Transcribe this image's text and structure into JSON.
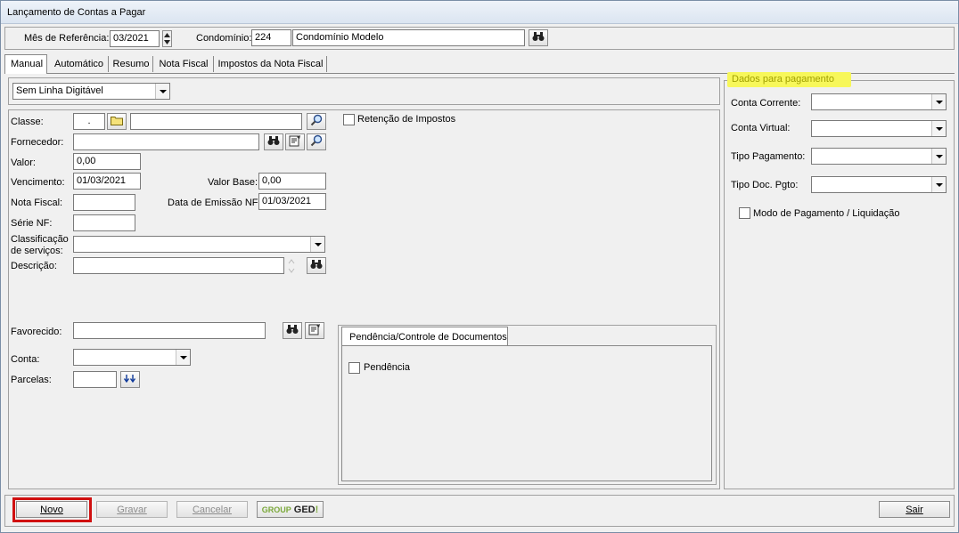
{
  "window": {
    "title": "Lançamento de Contas a Pagar"
  },
  "header": {
    "mes_label": "Mês de Referência:",
    "mes_value": "03/2021",
    "condominio_label": "Condomínio:",
    "condominio_code": "224",
    "condominio_name": "Condomínio Modelo"
  },
  "tabs": [
    {
      "label": "Manual"
    },
    {
      "label": "Automático"
    },
    {
      "label": "Resumo"
    },
    {
      "label": "Nota Fiscal"
    },
    {
      "label": "Impostos da Nota Fiscal"
    }
  ],
  "form": {
    "linha_digitavel": "Sem Linha Digitável",
    "classe_label": "Classe:",
    "classe_value": ".",
    "fornecedor_label": "Fornecedor:",
    "valor_label": "Valor:",
    "valor_value": "0,00",
    "vencimento_label": "Vencimento:",
    "vencimento_value": "01/03/2021",
    "valor_base_label": "Valor Base:",
    "valor_base_value": "0,00",
    "nota_fiscal_label": "Nota Fiscal:",
    "data_emissao_label": "Data de Emissão NF:",
    "data_emissao_value": "01/03/2021",
    "serie_label": "Série NF:",
    "classificacao_label_1": "Classificação",
    "classificacao_label_2": "de serviços:",
    "descricao_label": "Descrição:",
    "favorecido_label": "Favorecido:",
    "conta_label": "Conta:",
    "parcelas_label": "Parcelas:",
    "retencao_label": "Retenção de Impostos"
  },
  "pendencia": {
    "tab_label": "Pendência/Controle de Documentos",
    "checkbox_label": "Pendência"
  },
  "pagamento": {
    "group_title": "Dados para pagamento",
    "conta_corrente_label": "Conta Corrente:",
    "conta_virtual_label": "Conta Virtual:",
    "tipo_pagamento_label": "Tipo Pagamento:",
    "tipo_doc_label": "Tipo Doc. Pgto:",
    "modo_label": "Modo de Pagamento / Liquidação"
  },
  "footer": {
    "novo": "Novo",
    "gravar": "Gravar",
    "cancelar": "Cancelar",
    "ged_group": "GROUP",
    "ged_text": "GED",
    "ged_bang": "!",
    "sair": "Sair"
  },
  "colors": {
    "highlight_border": "#d01010",
    "group_title_bg": "#f7f75a"
  }
}
